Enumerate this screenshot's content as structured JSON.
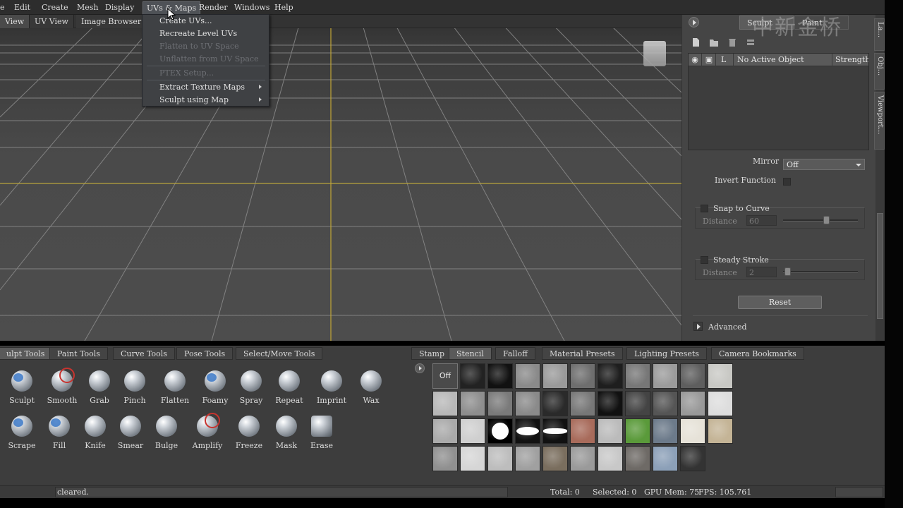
{
  "menubar": {
    "items": [
      "e",
      "Edit",
      "Create",
      "Mesh",
      "Display",
      "UVs & Maps",
      "Render",
      "Windows",
      "Help"
    ]
  },
  "viewport_tabs": [
    "View",
    "UV View",
    "Image Browser"
  ],
  "dropdown": {
    "items": [
      {
        "label": "Create UVs...",
        "enabled": true
      },
      {
        "label": "Recreate Level UVs",
        "enabled": true
      },
      {
        "label": "Flatten to UV Space",
        "enabled": false
      },
      {
        "label": "Unflatten from UV Space",
        "enabled": false
      },
      {
        "label": "PTEX Setup...",
        "enabled": false
      },
      {
        "label": "Extract Texture Maps",
        "enabled": true,
        "submenu": true
      },
      {
        "label": "Sculpt using Map",
        "enabled": true,
        "submenu": true
      }
    ]
  },
  "right_panel": {
    "tabs": [
      "Sculpt",
      "Paint"
    ],
    "watermark": "中新金桥",
    "layer_columns": [
      "L",
      "No Active Object",
      "Strength"
    ],
    "mirror_label": "Mirror",
    "mirror_value": "Off",
    "invert_function_label": "Invert Function",
    "snap_to_curve_label": "Snap to Curve",
    "snap_distance_label": "Distance",
    "snap_distance_value": "60",
    "steady_stroke_label": "Steady Stroke",
    "steady_distance_label": "Distance",
    "steady_distance_value": "2",
    "reset_label": "Reset",
    "advanced_label": "Advanced",
    "side_tabs": [
      "La...",
      "Obj...",
      "Viewport..."
    ]
  },
  "tool_tray": {
    "tabs": [
      "ulpt Tools",
      "Paint Tools",
      "Curve Tools",
      "Pose Tools",
      "Select/Move Tools"
    ],
    "tools_row1": [
      "Sculpt",
      "Smooth",
      "Grab",
      "Pinch",
      "Flatten",
      "Foamy",
      "Spray",
      "Repeat",
      "Imprint",
      "Wax"
    ],
    "tools_row2": [
      "Scrape",
      "Fill",
      "Knife",
      "Smear",
      "Bulge",
      "Amplify",
      "Freeze",
      "Mask",
      "Erase"
    ]
  },
  "stamp_tray": {
    "tabs": [
      "Stamp",
      "Stencil",
      "Falloff",
      "Material Presets",
      "Lighting Presets",
      "Camera Bookmarks"
    ],
    "off_label": "Off"
  },
  "status": {
    "message": "cleared.",
    "total": "Total: 0",
    "selected": "Selected: 0",
    "gpu_mem": "GPU Mem: 75",
    "fps": "FPS: 105.761"
  }
}
